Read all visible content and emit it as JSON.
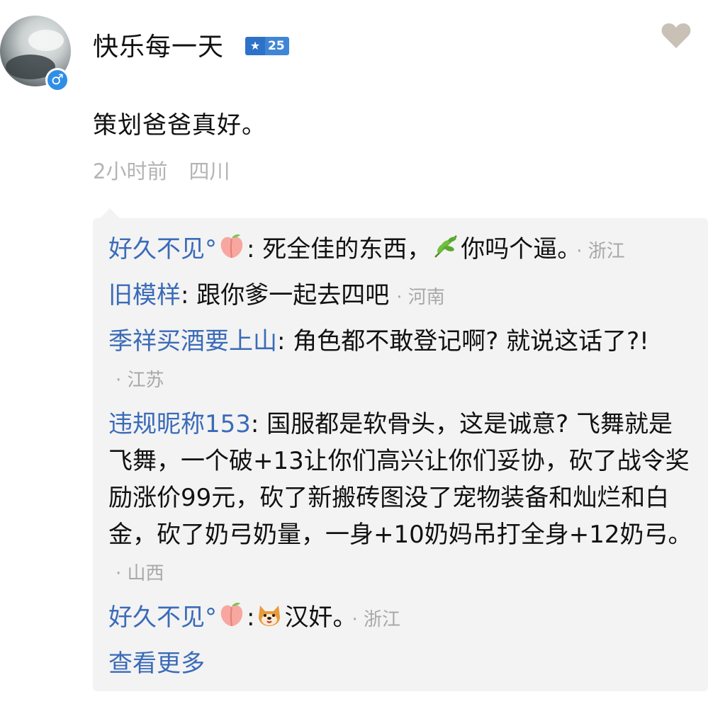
{
  "post": {
    "username": "快乐每一天",
    "level": "25",
    "content": "策划爸爸真好。",
    "time": "2小时前",
    "location": "四川",
    "gender_symbol": "♂",
    "like_icon": "heart-icon"
  },
  "replies": [
    {
      "author": "好久不见°",
      "author_emoji": "peach-emoji",
      "colon": ":",
      "text_before": " 死全佳的东西，",
      "inline_emoji": "herb-emoji",
      "text_after": "你吗个逼。",
      "location": "· 浙江"
    },
    {
      "author": "旧模样",
      "colon": ":",
      "text": " 跟你爹一起去四吧",
      "location": "· 河南"
    },
    {
      "author": "季祥买酒要上山",
      "colon": ":",
      "text": " 角色都不敢登记啊? 就说这话了?!",
      "location": "· 江苏"
    },
    {
      "author": "违规昵称153",
      "colon": ":",
      "text": " 国服都是软骨头，这是诚意? 飞舞就是飞舞，一个破+13让你们高兴让你们妥协，砍了战令奖励涨价99元，砍了新搬砖图没了宠物装备和灿烂和白金，砍了奶弓奶量，一身+10奶妈吊打全身+12奶弓。",
      "location": "· 山西"
    },
    {
      "author": "好久不见°",
      "author_emoji": "peach-emoji",
      "colon": ":",
      "inline_emoji": "shiba-dog-emoji",
      "text": "汉奸。",
      "location": "· 浙江"
    }
  ],
  "view_more": "查看更多",
  "colors": {
    "author_link": "#3a6bb8",
    "meta_gray": "#b4b4b4",
    "panel_bg": "#f3f3f3",
    "gender_badge": "#2f8ee6",
    "level_badge": "#3f86d6"
  }
}
